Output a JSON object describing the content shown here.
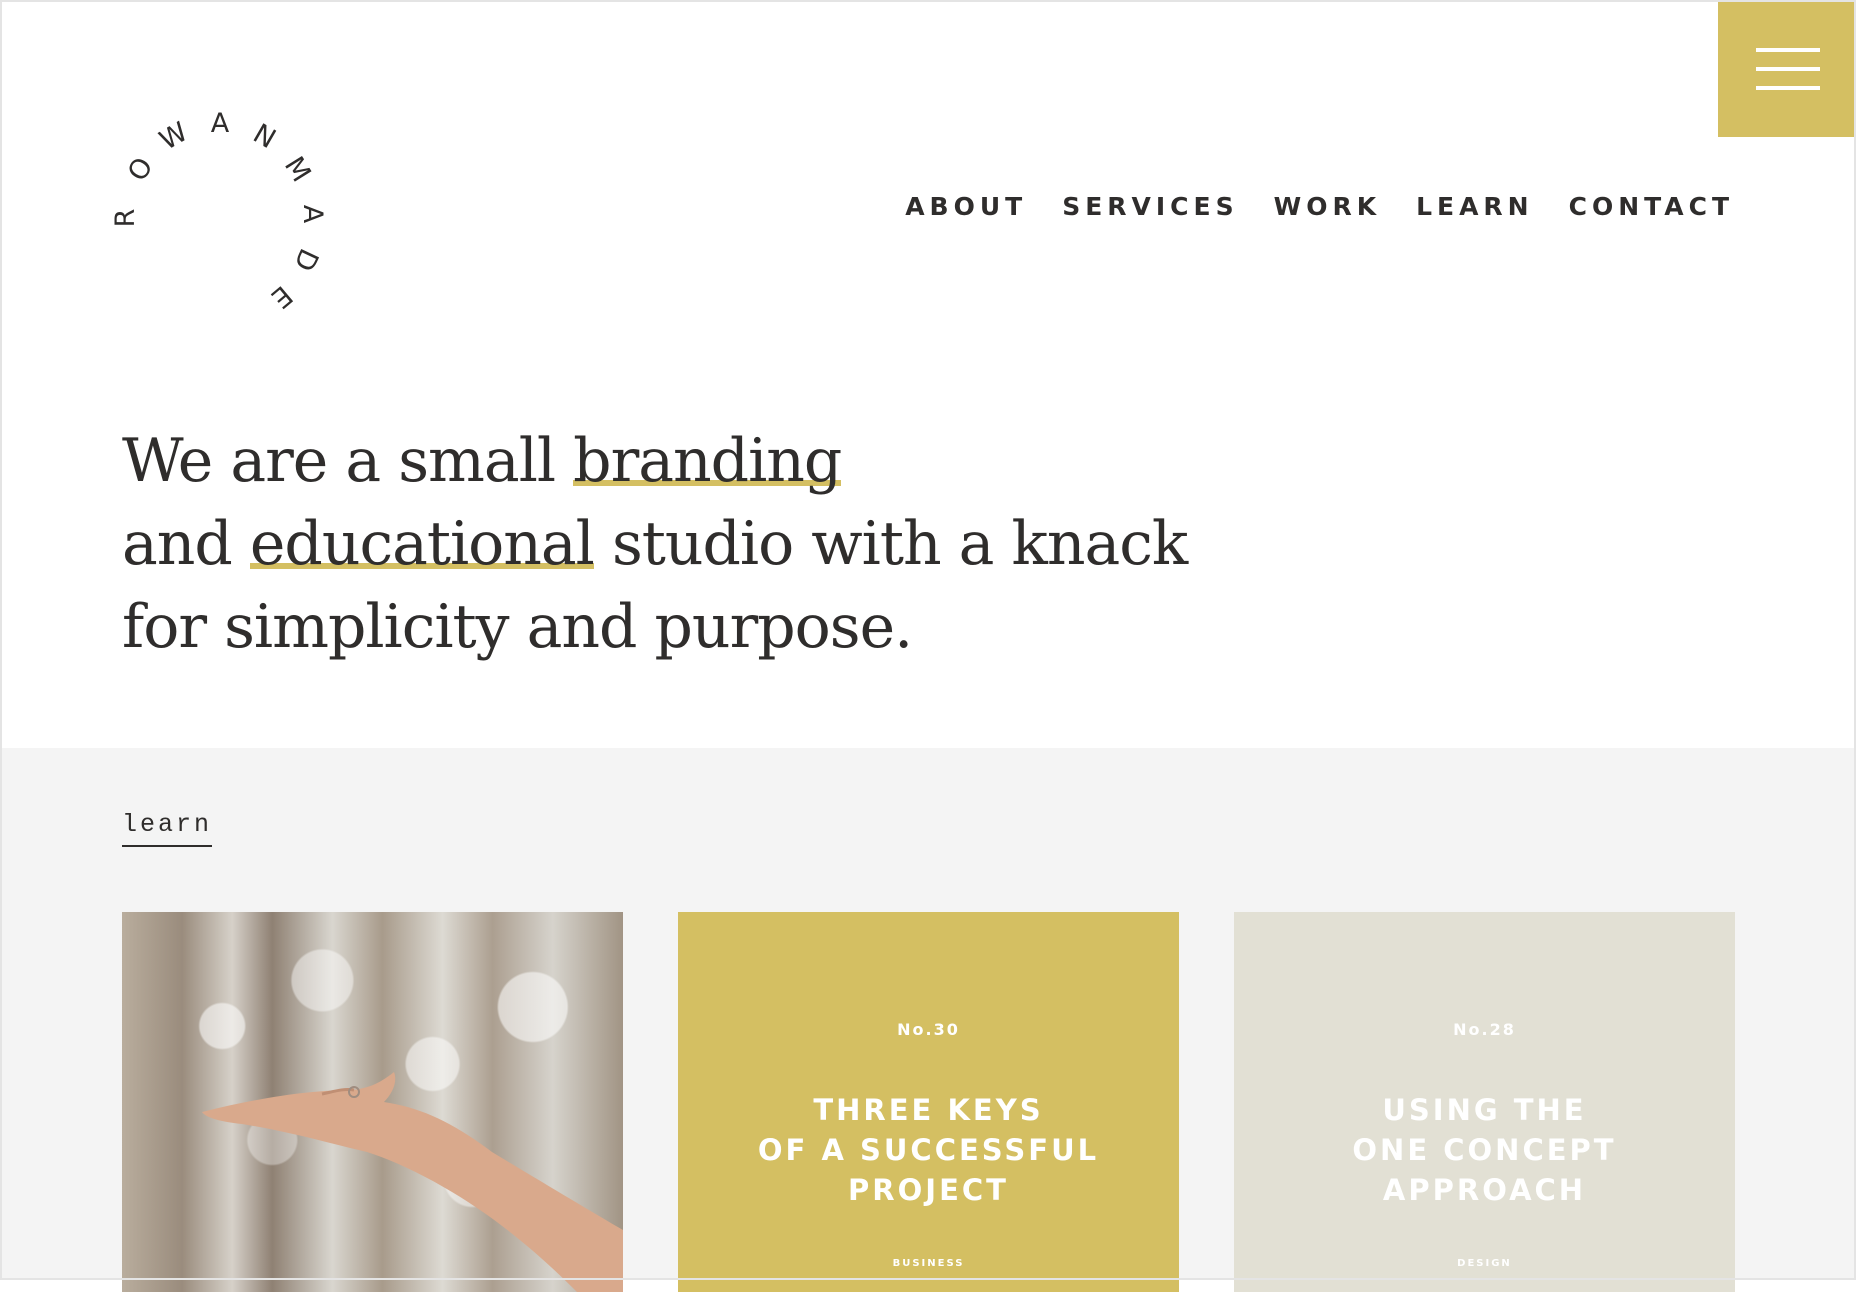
{
  "brand": {
    "name": "ROWANMADE",
    "accent": "#d4bf62",
    "text_color": "#2f2d2c"
  },
  "menu_button": {
    "icon": "hamburger-icon"
  },
  "nav": [
    "ABOUT",
    "SERVICES",
    "WORK",
    "LEARN",
    "CONTACT"
  ],
  "hero": {
    "line1_a": "We are a small ",
    "line1_b": "branding",
    "line2_a": "and ",
    "line2_b": "educational",
    "line2_c": " studio with a knack",
    "line3": "for simplicity and purpose."
  },
  "learn": {
    "heading": "learn",
    "cards": [
      {
        "type": "photo",
        "image": "hand-in-forest-photo"
      },
      {
        "number": "No.30",
        "title": "THREE KEYS\nOF A SUCCESSFUL\nPROJECT",
        "category": "BUSINESS",
        "color": "#d4bf62"
      },
      {
        "number": "No.28",
        "title": "USING THE\nONE CONCEPT\nAPPROACH",
        "category": "DESIGN",
        "color": "#e2e0d4"
      }
    ]
  }
}
